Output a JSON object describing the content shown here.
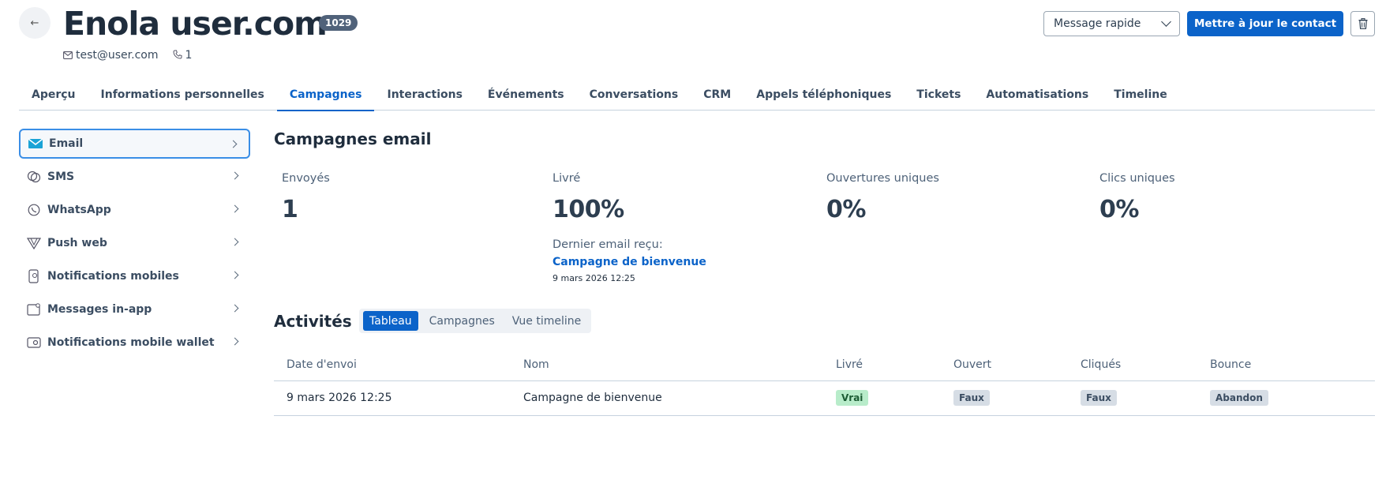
{
  "header": {
    "back_glyph": "←",
    "title": "Enola user.com",
    "id_badge": "1029",
    "email": "test@user.com",
    "phone_count": "1",
    "quick_message": "Message rapide",
    "update_button": "Mettre à jour le contact"
  },
  "tabs": [
    {
      "label": "Aperçu"
    },
    {
      "label": "Informations personnelles"
    },
    {
      "label": "Campagnes",
      "active": true
    },
    {
      "label": "Interactions"
    },
    {
      "label": "Événements"
    },
    {
      "label": "Conversations"
    },
    {
      "label": "CRM"
    },
    {
      "label": "Appels téléphoniques"
    },
    {
      "label": "Tickets"
    },
    {
      "label": "Automatisations"
    },
    {
      "label": "Timeline"
    }
  ],
  "sidebar": {
    "items": [
      {
        "label": "Email",
        "icon": "mail-icon",
        "active": true
      },
      {
        "label": "SMS",
        "icon": "sms-icon"
      },
      {
        "label": "WhatsApp",
        "icon": "whatsapp-icon"
      },
      {
        "label": "Push web",
        "icon": "push-web-icon"
      },
      {
        "label": "Notifications mobiles",
        "icon": "mobile-notification-icon"
      },
      {
        "label": "Messages in-app",
        "icon": "in-app-message-icon"
      },
      {
        "label": "Notifications mobile wallet",
        "icon": "wallet-icon"
      }
    ]
  },
  "main": {
    "section_title": "Campagnes email",
    "stats": [
      {
        "label": "Envoyés",
        "value": "1"
      },
      {
        "label": "Livré",
        "value": "100%"
      },
      {
        "label": "Ouvertures uniques",
        "value": "0%"
      },
      {
        "label": "Clics uniques",
        "value": "0%"
      }
    ],
    "last_email": {
      "label": "Dernier email reçu:",
      "campaign": "Campagne de bienvenue",
      "date": "9 mars 2026 12:25"
    },
    "activities_title": "Activités",
    "view_toggle": [
      "Tableau",
      "Campagnes",
      "Vue timeline"
    ],
    "table": {
      "headers": [
        "Date d'envoi",
        "Nom",
        "Livré",
        "Ouvert",
        "Cliqués",
        "Bounce"
      ],
      "rows": [
        {
          "date": "9 mars 2026 12:25",
          "name": "Campagne de bienvenue",
          "delivered": "Vrai",
          "opened": "Faux",
          "clicked": "Faux",
          "bounce": "Abandon"
        }
      ]
    }
  },
  "colors": {
    "accent": "#0b63c9",
    "text": "#2d3e50",
    "success_bg": "#b8ecca",
    "neutral_bg": "#d6dde5"
  }
}
